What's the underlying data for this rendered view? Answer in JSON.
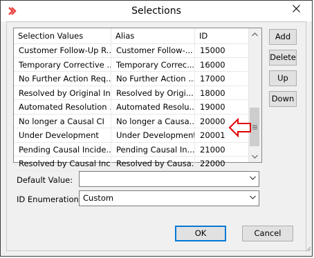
{
  "window": {
    "title": "Selections",
    "accent_color": "#e8403c",
    "annotation_color": "#e00000"
  },
  "table": {
    "columns": [
      "Selection Values",
      "Alias",
      "ID"
    ],
    "rows": [
      [
        "Customer Follow-Up R...",
        "Customer Follow-...",
        "15000"
      ],
      [
        "Temporary Corrective ...",
        "Temporary Correc...",
        "16000"
      ],
      [
        "No Further Action Req...",
        "No Further Action ...",
        "17000"
      ],
      [
        "Resolved by Original In...",
        "Resolved by Origi...",
        "18000"
      ],
      [
        "Automated Resolution ...",
        "Automated Resolu...",
        "19000"
      ],
      [
        "No longer a Causal CI",
        "No longer a Causa...",
        "20000"
      ],
      [
        "Under Development",
        "Under Development",
        "20001"
      ],
      [
        "Pending Causal Incide...",
        "Pending Causal In...",
        "21000"
      ],
      [
        "Resolved by Causal Inc...",
        "Resolved by Causa...",
        "22000"
      ]
    ]
  },
  "side_buttons": {
    "add": "Add",
    "delete": "Delete",
    "up": "Up",
    "down": "Down"
  },
  "fields": {
    "default_value_label": "Default Value:",
    "default_value": "",
    "id_enum_label": "ID Enumeration:",
    "id_enum_value": "Custom"
  },
  "footer": {
    "ok": "OK",
    "cancel": "Cancel"
  }
}
